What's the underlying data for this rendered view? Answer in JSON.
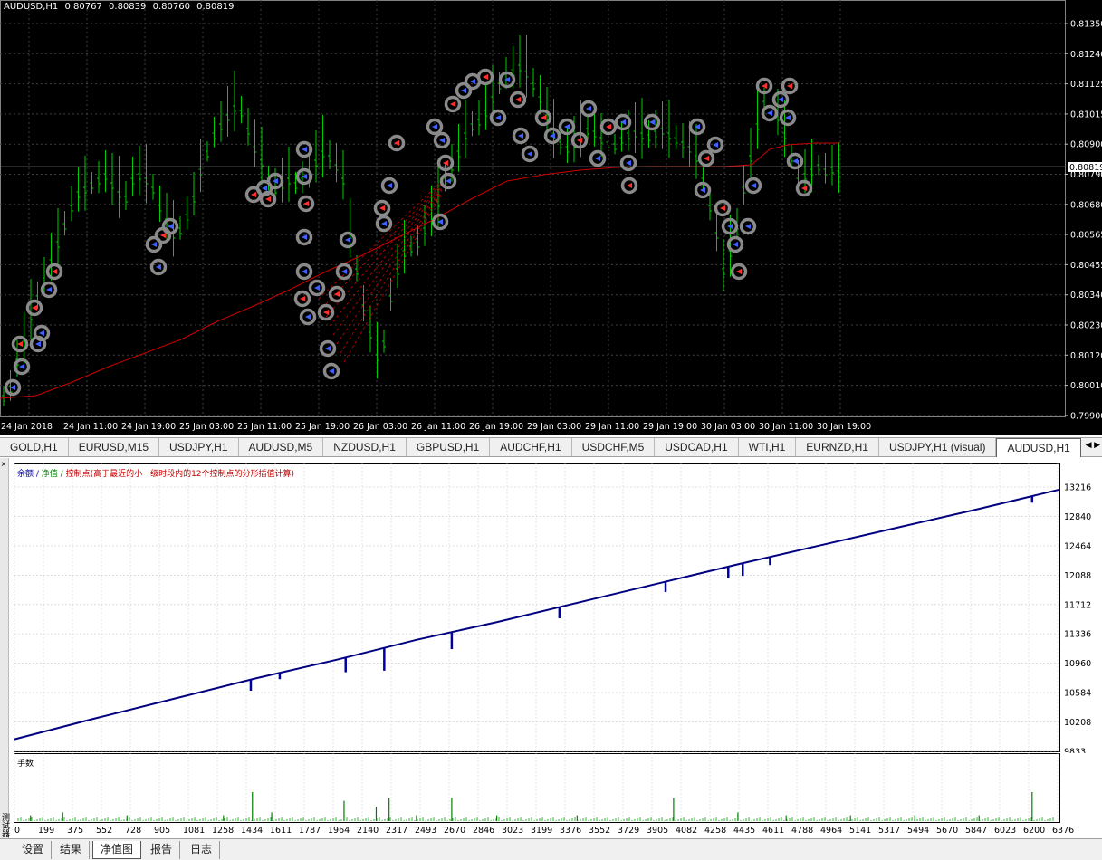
{
  "price_chart": {
    "symbol": "AUDUSD,H1",
    "ohlc": [
      "0.80767",
      "0.80839",
      "0.80760",
      "0.80819"
    ],
    "current_price": "0.80819",
    "price_ticks": [
      "0.81350",
      "0.81240",
      "0.81125",
      "0.81015",
      "0.80900",
      "0.80790",
      "0.80680",
      "0.80565",
      "0.80455",
      "0.80340",
      "0.80230",
      "0.80120",
      "0.80010",
      "0.79900"
    ],
    "time_ticks": [
      "24 Jan 2018",
      "24 Jan 11:00",
      "24 Jan 19:00",
      "25 Jan 03:00",
      "25 Jan 11:00",
      "25 Jan 19:00",
      "26 Jan 03:00",
      "26 Jan 11:00",
      "26 Jan 19:00",
      "29 Jan 03:00",
      "29 Jan 11:00",
      "29 Jan 19:00",
      "30 Jan 03:00",
      "30 Jan 11:00",
      "30 Jan 19:00"
    ],
    "colors": {
      "background": "#000000",
      "bar": "#00cc00",
      "ma_line": "#cc0000",
      "grid": "#404040"
    }
  },
  "symbol_tabs": [
    {
      "label": "GOLD,H1"
    },
    {
      "label": "EURUSD,M15"
    },
    {
      "label": "USDJPY,H1"
    },
    {
      "label": "AUDUSD,M5"
    },
    {
      "label": "NZDUSD,H1"
    },
    {
      "label": "GBPUSD,H1"
    },
    {
      "label": "AUDCHF,H1"
    },
    {
      "label": "USDCHF,M5"
    },
    {
      "label": "USDCAD,H1"
    },
    {
      "label": "WTI,H1"
    },
    {
      "label": "EURNZD,H1"
    },
    {
      "label": "USDJPY,H1 (visual)"
    },
    {
      "label": "AUDUSD,H1"
    }
  ],
  "tab_arrows": "◀ ▶",
  "tester": {
    "legend": {
      "balance": "余额",
      "sep1": " / ",
      "equity": "净值",
      "sep2": " / ",
      "control": "控制点(高于最近的小一级时段内的12个控制点的分形插值计算)"
    },
    "lots_label": "手数",
    "strip_label": "测试器",
    "close_glyph": "×"
  },
  "chart_data": [
    {
      "type": "line",
      "title": "",
      "ylabel": "",
      "xlabel": "",
      "y_ticks": [
        "13216",
        "12840",
        "12464",
        "12088",
        "11712",
        "11336",
        "10960",
        "10584",
        "10208",
        "9833"
      ],
      "ylim": [
        9833,
        13216
      ],
      "series": [
        {
          "name": "余额",
          "color": "#000080",
          "x": [
            0,
            500,
            1000,
            1500,
            2000,
            2500,
            3000,
            3500,
            4000,
            4500,
            5000,
            5500,
            6000,
            6500
          ],
          "values": [
            9990,
            10260,
            10520,
            10780,
            11020,
            11280,
            11510,
            11760,
            12010,
            12260,
            12500,
            12740,
            12980,
            13230
          ]
        }
      ],
      "equity_dips": [
        {
          "x": 1470,
          "value": 10620
        },
        {
          "x": 1650,
          "value": 10770
        },
        {
          "x": 2060,
          "value": 10860
        },
        {
          "x": 2300,
          "value": 10880
        },
        {
          "x": 2720,
          "value": 11160
        },
        {
          "x": 3390,
          "value": 11560
        },
        {
          "x": 4050,
          "value": 11900
        },
        {
          "x": 4440,
          "value": 12080
        },
        {
          "x": 4530,
          "value": 12110
        },
        {
          "x": 4700,
          "value": 12250
        },
        {
          "x": 6330,
          "value": 13060
        }
      ],
      "x_ticks": [
        "0",
        "199",
        "375",
        "552",
        "728",
        "905",
        "1081",
        "1258",
        "1434",
        "1611",
        "1787",
        "1964",
        "2140",
        "2317",
        "2493",
        "2670",
        "2846",
        "3023",
        "3199",
        "3376",
        "3552",
        "3729",
        "3905",
        "4082",
        "4258",
        "4435",
        "4611",
        "4788",
        "4964",
        "5141",
        "5317",
        "5494",
        "5670",
        "5847",
        "6023",
        "6200",
        "6376"
      ],
      "xlim": [
        0,
        6500
      ]
    },
    {
      "type": "bar",
      "title": "",
      "series": [
        {
          "name": "手数",
          "color": "#008000",
          "x": [
            100,
            300,
            700,
            1300,
            1480,
            1600,
            2050,
            2250,
            2330,
            2500,
            2720,
            3000,
            3500,
            4100,
            4500,
            4800,
            5200,
            5600,
            6000,
            6330
          ],
          "values": [
            0.2,
            0.3,
            0.2,
            0.2,
            1.0,
            0.3,
            0.7,
            0.5,
            0.8,
            0.2,
            0.8,
            0.2,
            0.2,
            0.8,
            0.3,
            0.2,
            0.2,
            0.2,
            0.2,
            1.0
          ]
        }
      ]
    }
  ],
  "bottom_tabs": [
    {
      "label": "设置"
    },
    {
      "label": "结果"
    },
    {
      "label": "净值图"
    },
    {
      "label": "报告"
    },
    {
      "label": "日志"
    }
  ]
}
